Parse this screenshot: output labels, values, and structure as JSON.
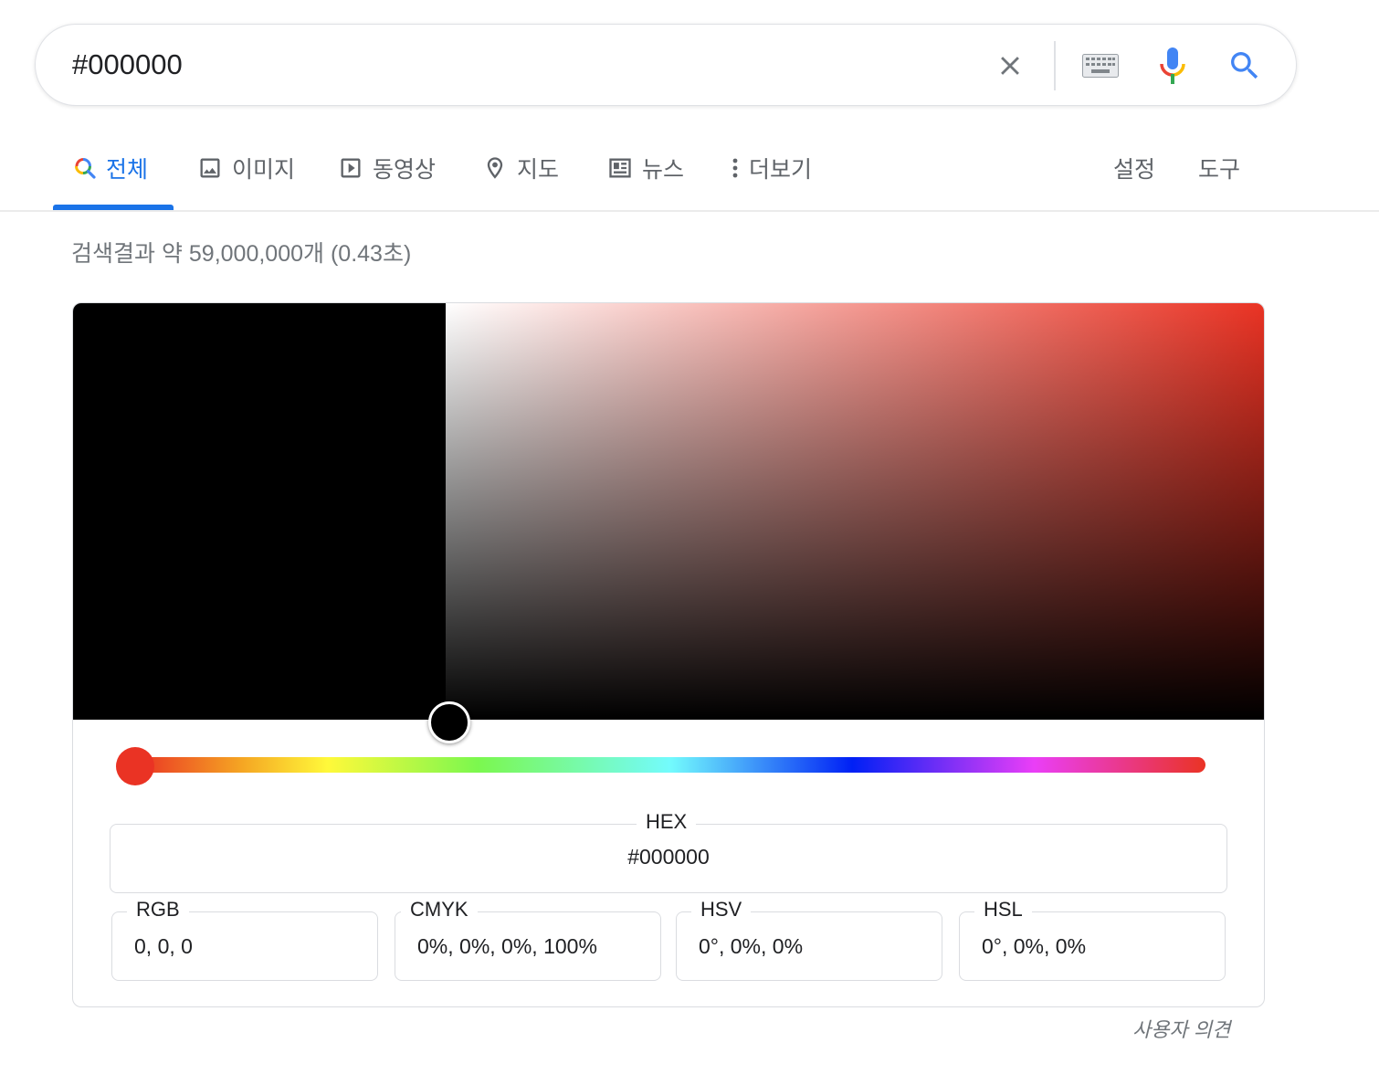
{
  "search": {
    "query": "#000000",
    "icons": {
      "clear": "close-icon",
      "keyboard": "keyboard-icon",
      "voice": "microphone-icon",
      "search": "search-icon"
    }
  },
  "tabs": [
    {
      "label": "전체",
      "icon": "google-search-icon",
      "active": true
    },
    {
      "label": "이미지",
      "icon": "image-icon"
    },
    {
      "label": "동영상",
      "icon": "video-play-icon"
    },
    {
      "label": "지도",
      "icon": "map-pin-icon"
    },
    {
      "label": "뉴스",
      "icon": "news-icon"
    },
    {
      "label": "더보기",
      "icon": "more-vert-icon"
    }
  ],
  "tools": {
    "settings": "설정",
    "tools": "도구"
  },
  "result_stats": "검색결과 약 59,000,000개 (0.43초)",
  "color_picker": {
    "selected_color": "#000000",
    "hue_color": "#ea3324",
    "hue_position": 0,
    "hex": {
      "label": "HEX",
      "value": "#000000"
    },
    "rgb": {
      "label": "RGB",
      "value": "0, 0, 0"
    },
    "cmyk": {
      "label": "CMYK",
      "value": "0%, 0%, 0%, 100%"
    },
    "hsv": {
      "label": "HSV",
      "value": "0°, 0%, 0%"
    },
    "hsl": {
      "label": "HSL",
      "value": "0°, 0%, 0%"
    }
  },
  "feedback": "사용자 의견",
  "colors": {
    "accent": "#1a73e8",
    "muted_text": "#5f6368",
    "border": "#dadce0"
  }
}
